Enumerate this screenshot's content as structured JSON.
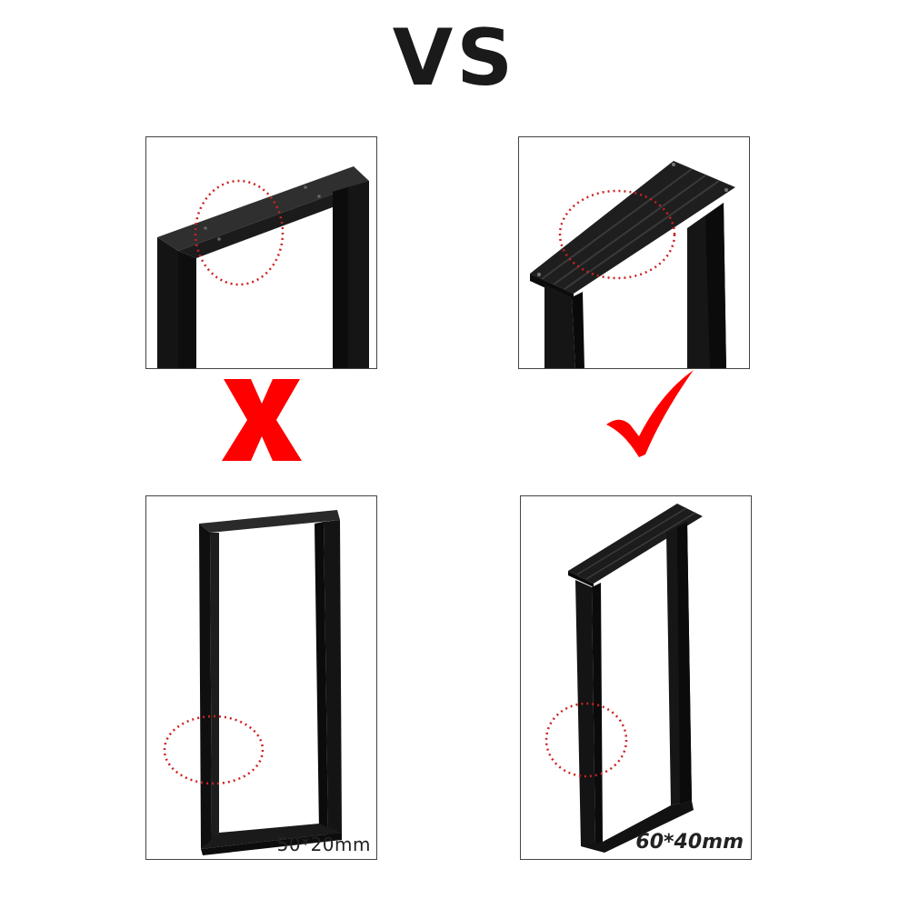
{
  "header": {
    "title": "VS"
  },
  "panels": {
    "bottom_left": {
      "label": "50*20mm"
    },
    "bottom_right": {
      "label": "60*40mm"
    }
  },
  "colors": {
    "frame": "#121212",
    "frame_highlight": "#2e2e2e",
    "cross": "#ff0000",
    "check": "#ff0000",
    "circle": "#cc2222"
  },
  "icons": [
    "red-x-icon",
    "red-check-icon"
  ]
}
